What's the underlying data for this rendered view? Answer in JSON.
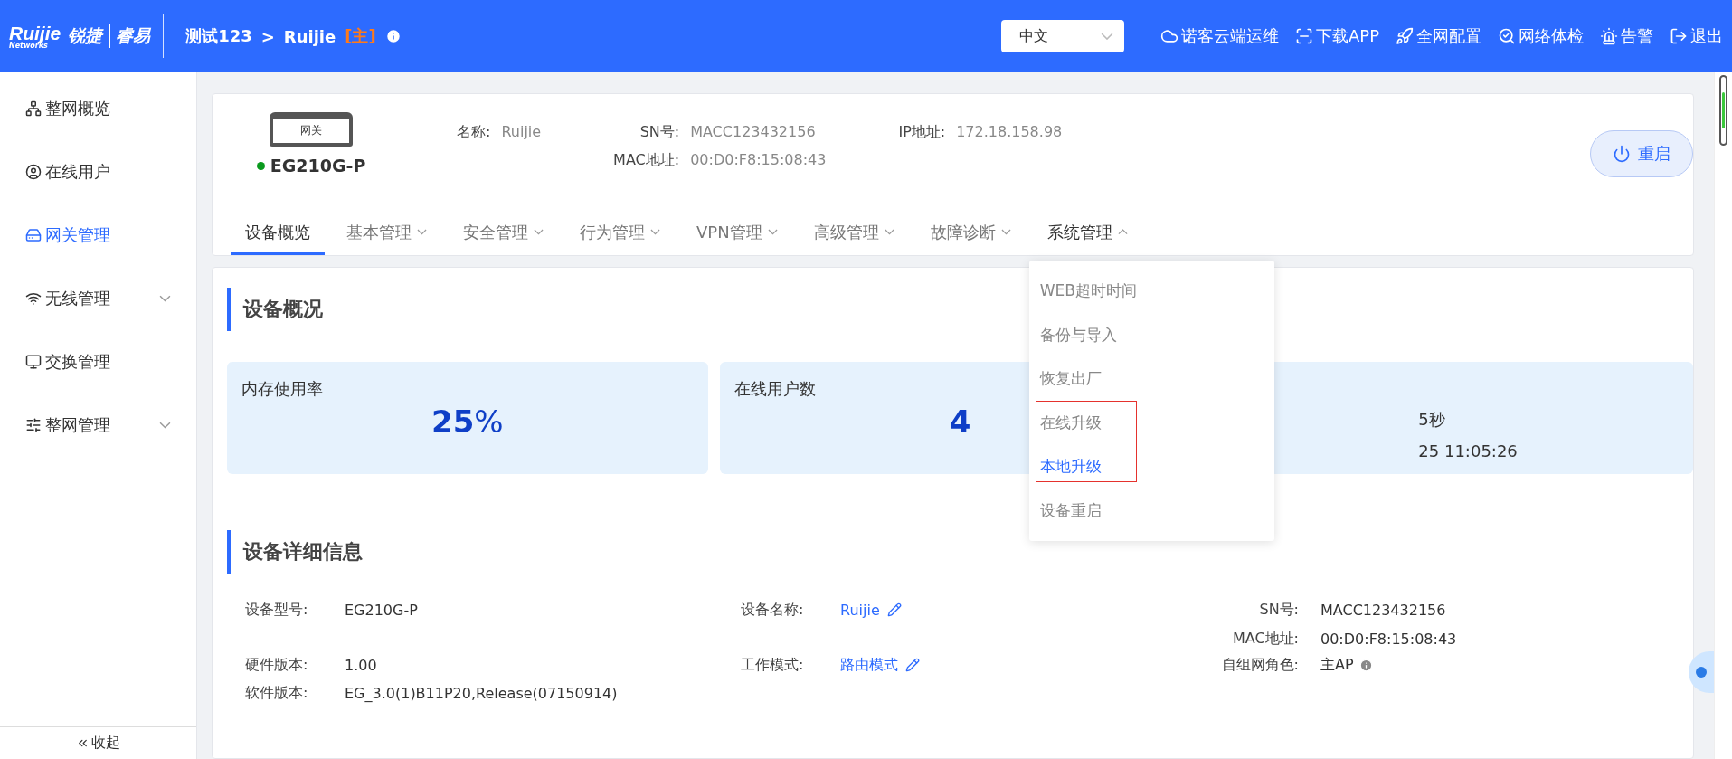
{
  "header": {
    "logo": {
      "brand": "Ruijie",
      "sub": "Networks",
      "cn": "锐捷",
      "product": "睿易"
    },
    "breadcrumb": {
      "project": "测试123",
      "separator": ">",
      "device": "Ruijie",
      "role": "[主]"
    },
    "language": {
      "value": "中文"
    },
    "actions": [
      {
        "label": "诺客云端运维"
      },
      {
        "label": "下载APP"
      },
      {
        "label": "全网配置"
      },
      {
        "label": "网络体检"
      },
      {
        "label": "告警"
      },
      {
        "label": "退出"
      }
    ]
  },
  "sidebar": {
    "items": [
      {
        "label": "整网概览",
        "selected": false,
        "kind": "link"
      },
      {
        "label": "在线用户",
        "selected": false,
        "kind": "link"
      },
      {
        "label": "网关管理",
        "selected": true,
        "kind": "link"
      },
      {
        "label": "无线管理",
        "selected": false,
        "kind": "group",
        "expanded": false
      },
      {
        "label": "交换管理",
        "selected": false,
        "kind": "link"
      },
      {
        "label": "整网管理",
        "selected": false,
        "kind": "group",
        "expanded": false
      }
    ],
    "collapse": {
      "label": "收起"
    }
  },
  "device": {
    "image_label": "网关",
    "online": true,
    "model": "EG210G-P",
    "info_columns": [
      [
        {
          "label": "名称:",
          "value": "Ruijie"
        }
      ],
      [
        {
          "label": "SN号:",
          "value": "MACC123432156"
        },
        {
          "label": "MAC地址:",
          "value": "00:D0:F8:15:08:43"
        }
      ],
      [
        {
          "label": "IP地址:",
          "value": "172.18.158.98"
        }
      ]
    ],
    "restart_button": "重启",
    "tabs": [
      {
        "label": "设备概览",
        "selected": true,
        "kind": "plain"
      },
      {
        "label": "基本管理",
        "selected": false,
        "kind": "menu",
        "expanded": false
      },
      {
        "label": "安全管理",
        "selected": false,
        "kind": "menu",
        "expanded": false
      },
      {
        "label": "行为管理",
        "selected": false,
        "kind": "menu",
        "expanded": false
      },
      {
        "label": "VPN管理",
        "selected": false,
        "kind": "menu",
        "expanded": false
      },
      {
        "label": "高级管理",
        "selected": false,
        "kind": "menu",
        "expanded": false
      },
      {
        "label": "故障诊断",
        "selected": false,
        "kind": "menu",
        "expanded": false
      },
      {
        "label": "系统管理",
        "selected": false,
        "kind": "menu",
        "expanded": true,
        "menu": [
          {
            "label": "WEB超时时间",
            "selected": false
          },
          {
            "label": "备份与导入",
            "selected": false
          },
          {
            "label": "恢复出厂",
            "selected": false
          },
          {
            "label": "在线升级",
            "selected": false
          },
          {
            "label": "本地升级",
            "selected": true
          },
          {
            "label": "设备重启",
            "selected": false
          }
        ]
      }
    ]
  },
  "overview": {
    "title": "设备概况",
    "cards": [
      {
        "kind": "stat",
        "label": "内存使用率",
        "value": "25",
        "unit": "%"
      },
      {
        "kind": "stat",
        "label": "在线用户数",
        "value": "4"
      },
      {
        "kind": "lines",
        "lines": [
          "5秒",
          "25 11:05:26"
        ]
      }
    ]
  },
  "details": {
    "title": "设备详细信息",
    "rows": [
      [
        {
          "label": "设备型号:",
          "value": "EG210G-P",
          "kind": "text"
        },
        {
          "label": "设备名称:",
          "value": "Ruijie",
          "kind": "editable"
        },
        {
          "label": "SN号:",
          "value": "MACC123432156",
          "kind": "text"
        }
      ],
      [
        null,
        null,
        {
          "label": "MAC地址:",
          "value": "00:D0:F8:15:08:43",
          "kind": "text"
        }
      ],
      [
        {
          "label": "硬件版本:",
          "value": "1.00",
          "kind": "text"
        },
        {
          "label": "工作模式:",
          "value": "路由模式",
          "kind": "editable"
        },
        {
          "label": "自组网角色:",
          "value": "主AP",
          "kind": "info"
        }
      ],
      [
        {
          "label": "软件版本:",
          "value": "EG_3.0(1)B11P20,Release(07150914)",
          "kind": "text"
        },
        null,
        null
      ]
    ]
  }
}
